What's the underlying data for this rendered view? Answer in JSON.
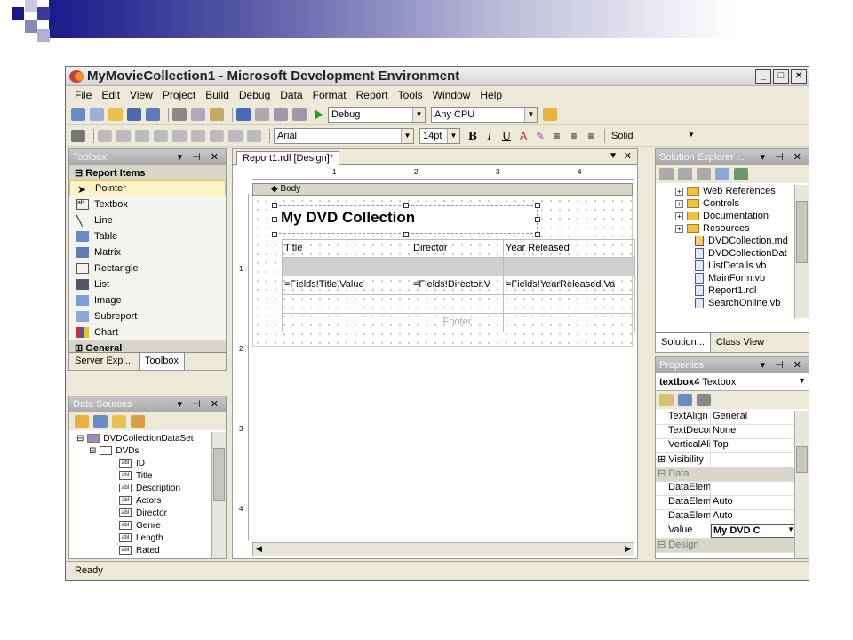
{
  "window": {
    "title": "MyMovieCollection1 - Microsoft Development Environment",
    "min": "_",
    "max": "□",
    "close": "×"
  },
  "menu": [
    "File",
    "Edit",
    "View",
    "Project",
    "Build",
    "Debug",
    "Data",
    "Format",
    "Report",
    "Tools",
    "Window",
    "Help"
  ],
  "toolbar1": {
    "config": "Debug",
    "platform": "Any CPU"
  },
  "toolbar2": {
    "font": "Arial",
    "size": "14pt",
    "bold": "B",
    "italic": "I",
    "underline": "U",
    "border_style": "Solid"
  },
  "toolbox": {
    "title": "Toolbox",
    "section": "Report Items",
    "items": [
      "Pointer",
      "Textbox",
      "Line",
      "Table",
      "Matrix",
      "Rectangle",
      "List",
      "Image",
      "Subreport",
      "Chart"
    ],
    "general": "General",
    "tabs": [
      "Server Expl...",
      "Toolbox"
    ]
  },
  "data_sources": {
    "title": "Data Sources",
    "dataset": "DVDCollectionDataSet",
    "table": "DVDs",
    "fields": [
      "ID",
      "Title",
      "Description",
      "Actors",
      "Director",
      "Genre",
      "Length",
      "Rated"
    ]
  },
  "designer": {
    "tab": "Report1.rdl [Design]*",
    "body_label": "Body",
    "report_title": "My DVD Collection",
    "headers": [
      "Title",
      "Director",
      "Year Released"
    ],
    "detail": [
      "=Fields!Title.Value",
      "=Fields!Director.V",
      "=Fields!YearReleased.Va"
    ],
    "footer": "Footer",
    "ruler_marks": [
      "1",
      "2",
      "3",
      "4"
    ],
    "ruler_v_marks": [
      "1",
      "2",
      "3",
      "4"
    ]
  },
  "solution": {
    "title": "Solution Explorer ...",
    "items": [
      {
        "label": "Web References",
        "type": "folder",
        "expand": "+"
      },
      {
        "label": "Controls",
        "type": "folder",
        "expand": "+"
      },
      {
        "label": "Documentation",
        "type": "folder",
        "expand": "+"
      },
      {
        "label": "Resources",
        "type": "folder",
        "expand": "+"
      },
      {
        "label": "DVDCollection.md",
        "type": "file"
      },
      {
        "label": "DVDCollectionDat",
        "type": "file"
      },
      {
        "label": "ListDetails.vb",
        "type": "file"
      },
      {
        "label": "MainForm.vb",
        "type": "file"
      },
      {
        "label": "Report1.rdl",
        "type": "file"
      },
      {
        "label": "SearchOnline.vb",
        "type": "file"
      }
    ],
    "tabs": [
      "Solution...",
      "Class View"
    ]
  },
  "properties": {
    "title": "Properties",
    "object": "textbox4",
    "object_type": "Textbox",
    "rows": [
      {
        "name": "TextAlign",
        "value": "General"
      },
      {
        "name": "TextDecora",
        "value": "None"
      },
      {
        "name": "VerticalAlign",
        "value": "Top"
      },
      {
        "name": "Visibility",
        "value": "",
        "expand": "⊞"
      },
      {
        "name": "Data",
        "value": "",
        "category": true,
        "expand": "⊟"
      },
      {
        "name": "DataElemer",
        "value": ""
      },
      {
        "name": "DataElemer",
        "value": "Auto"
      },
      {
        "name": "DataElemer",
        "value": "Auto"
      },
      {
        "name": "Value",
        "value": "My DVD C"
      },
      {
        "name": "Design",
        "value": "",
        "category": true,
        "expand": "⊟"
      }
    ]
  },
  "status": "Ready"
}
